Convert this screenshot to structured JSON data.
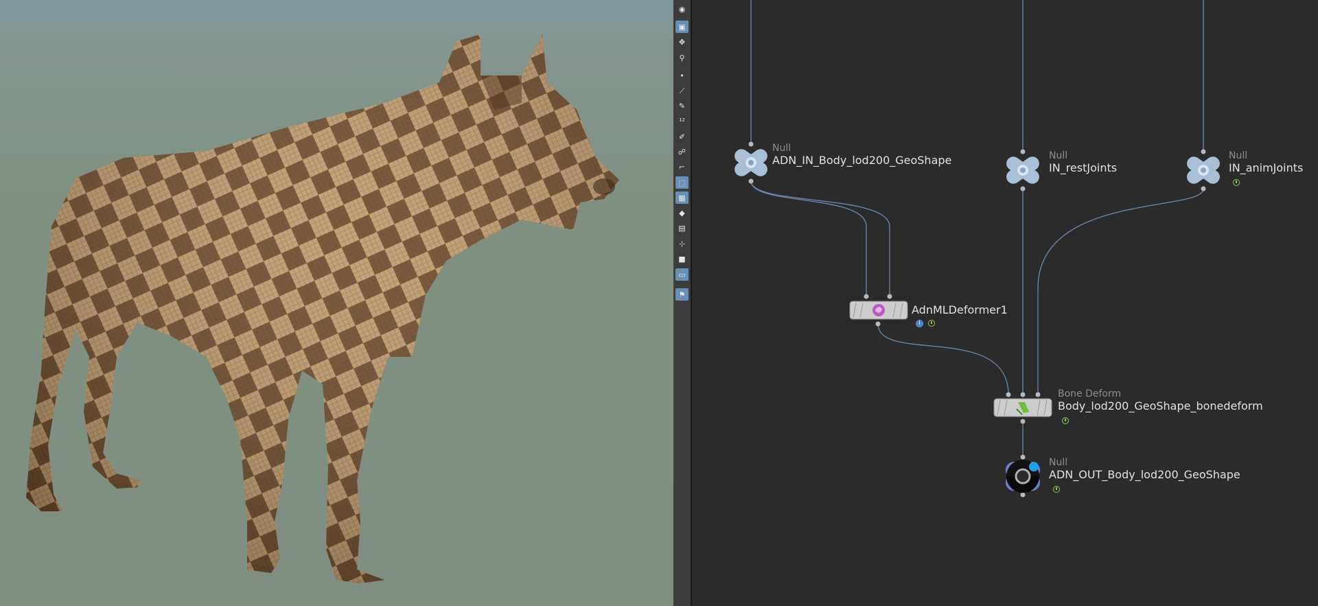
{
  "toolbar": {
    "icons": [
      "camera-icon",
      "view-select-icon",
      "transform-handle-icon",
      "pose-icon",
      "point-icon",
      "edge-icon",
      "brush-icon",
      "number-12-icon",
      "paint-icon",
      "sculpt-icon",
      "corner-icon",
      "select-active-icon",
      "uv-grid-icon",
      "diamond-icon",
      "group-icon",
      "snap-icon",
      "stop-icon",
      "display-options-icon",
      "pin-icon"
    ]
  },
  "nodes": {
    "in_body": {
      "type": "Null",
      "name": "ADN_IN_Body_lod200_GeoShape"
    },
    "rest_joints": {
      "type": "Null",
      "name": "IN_restJoints"
    },
    "anim_joints": {
      "type": "Null",
      "name": "IN_animJoints"
    },
    "ml_deformer": {
      "type": "",
      "name": "AdnMLDeformer1"
    },
    "bone_deform": {
      "type": "Bone Deform",
      "name": "Body_lod200_GeoShape_bonedeform"
    },
    "out_body": {
      "type": "Null",
      "name": "ADN_OUT_Body_lod200_GeoShape"
    }
  },
  "flags": {
    "info_glyph": "i"
  },
  "colors": {
    "wire": "#6a8bb0",
    "null_node": "#a9bfd6",
    "display_flag": "#8ec65a",
    "info_flag": "#4d86cf",
    "output_flag": "#1ea0e8",
    "viewport_bg": "#7f9081",
    "network_bg": "#2b2b2b"
  }
}
